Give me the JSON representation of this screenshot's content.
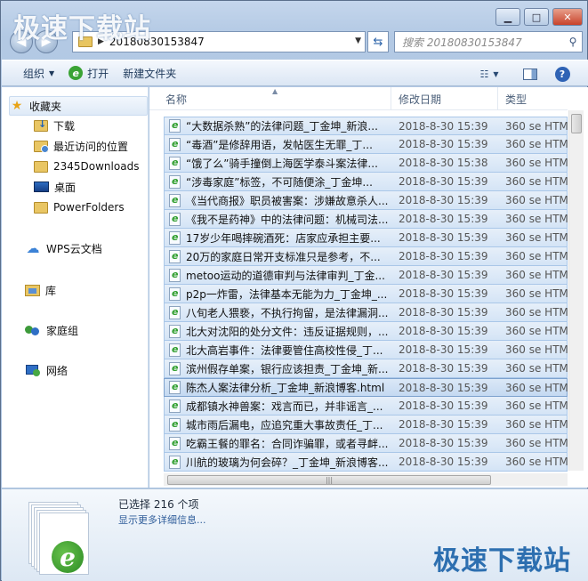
{
  "watermark": "极速下载站",
  "address": {
    "path": "20180830153847"
  },
  "search": {
    "placeholder": "搜索 20180830153847"
  },
  "toolbar": {
    "organize": "组织",
    "open": "打开",
    "new_folder": "新建文件夹"
  },
  "nav": {
    "favorites": "收藏夹",
    "items": [
      "下载",
      "最近访问的位置",
      "2345Downloads",
      "桌面",
      "PowerFolders"
    ],
    "wps": "WPS云文档",
    "libraries": "库",
    "homegroup": "家庭组",
    "network": "网络"
  },
  "columns": {
    "name": "名称",
    "date": "修改日期",
    "type": "类型"
  },
  "files": [
    {
      "name": "“大数据杀熟”的法律问题_丁金坤_新浪...",
      "date": "2018-8-30 15:39",
      "type": "360 se HTM"
    },
    {
      "name": "“毒酒”是修辞用语，发帖医生无罪_丁...",
      "date": "2018-8-30 15:39",
      "type": "360 se HTM"
    },
    {
      "name": "“饿了么”骑手撞倒上海医学泰斗案法律...",
      "date": "2018-8-30 15:38",
      "type": "360 se HTM"
    },
    {
      "name": "“涉毒家庭”标签，不可随便涂_丁金坤...",
      "date": "2018-8-30 15:39",
      "type": "360 se HTM"
    },
    {
      "name": "《当代商报》职员被害案：涉嫌故意杀人...",
      "date": "2018-8-30 15:39",
      "type": "360 se HTM"
    },
    {
      "name": "《我不是药神》中的法律问题：机械司法...",
      "date": "2018-8-30 15:39",
      "type": "360 se HTM"
    },
    {
      "name": "17岁少年喝摔碗酒死：店家应承担主要...",
      "date": "2018-8-30 15:39",
      "type": "360 se HTM"
    },
    {
      "name": "20万的家庭日常开支标准只是参考，不...",
      "date": "2018-8-30 15:39",
      "type": "360 se HTM"
    },
    {
      "name": "metoo运动的道德审判与法律审判_丁金...",
      "date": "2018-8-30 15:39",
      "type": "360 se HTM"
    },
    {
      "name": "p2p一炸雷，法律基本无能为力_丁金坤_...",
      "date": "2018-8-30 15:39",
      "type": "360 se HTM"
    },
    {
      "name": "八旬老人猥亵，不执行拘留，是法律漏洞...",
      "date": "2018-8-30 15:39",
      "type": "360 se HTM"
    },
    {
      "name": "北大对沈阳的处分文件：违反证据规则，...",
      "date": "2018-8-30 15:39",
      "type": "360 se HTM"
    },
    {
      "name": "北大高岩事件：法律要管住高校性侵_丁...",
      "date": "2018-8-30 15:39",
      "type": "360 se HTM"
    },
    {
      "name": "滨州假存单案，银行应该担责_丁金坤_新...",
      "date": "2018-8-30 15:39",
      "type": "360 se HTM"
    },
    {
      "name": "陈杰人案法律分析_丁金坤_新浪博客.html",
      "date": "2018-8-30 15:39",
      "type": "360 se HTM"
    },
    {
      "name": "成都镇水神兽案：戏言而已，并非谣言_...",
      "date": "2018-8-30 15:39",
      "type": "360 se HTM"
    },
    {
      "name": "城市雨后漏电，应追究重大事故责任_丁...",
      "date": "2018-8-30 15:39",
      "type": "360 se HTM"
    },
    {
      "name": "吃霸王餐的罪名：合同诈骗罪，或者寻衅...",
      "date": "2018-8-30 15:39",
      "type": "360 se HTM"
    },
    {
      "name": "川航的玻璃为何会碎？_丁金坤_新浪博客...",
      "date": "2018-8-30 15:39",
      "type": "360 se HTM"
    }
  ],
  "details": {
    "selected": "已选择 216 个项",
    "more": "显示更多详细信息..."
  }
}
